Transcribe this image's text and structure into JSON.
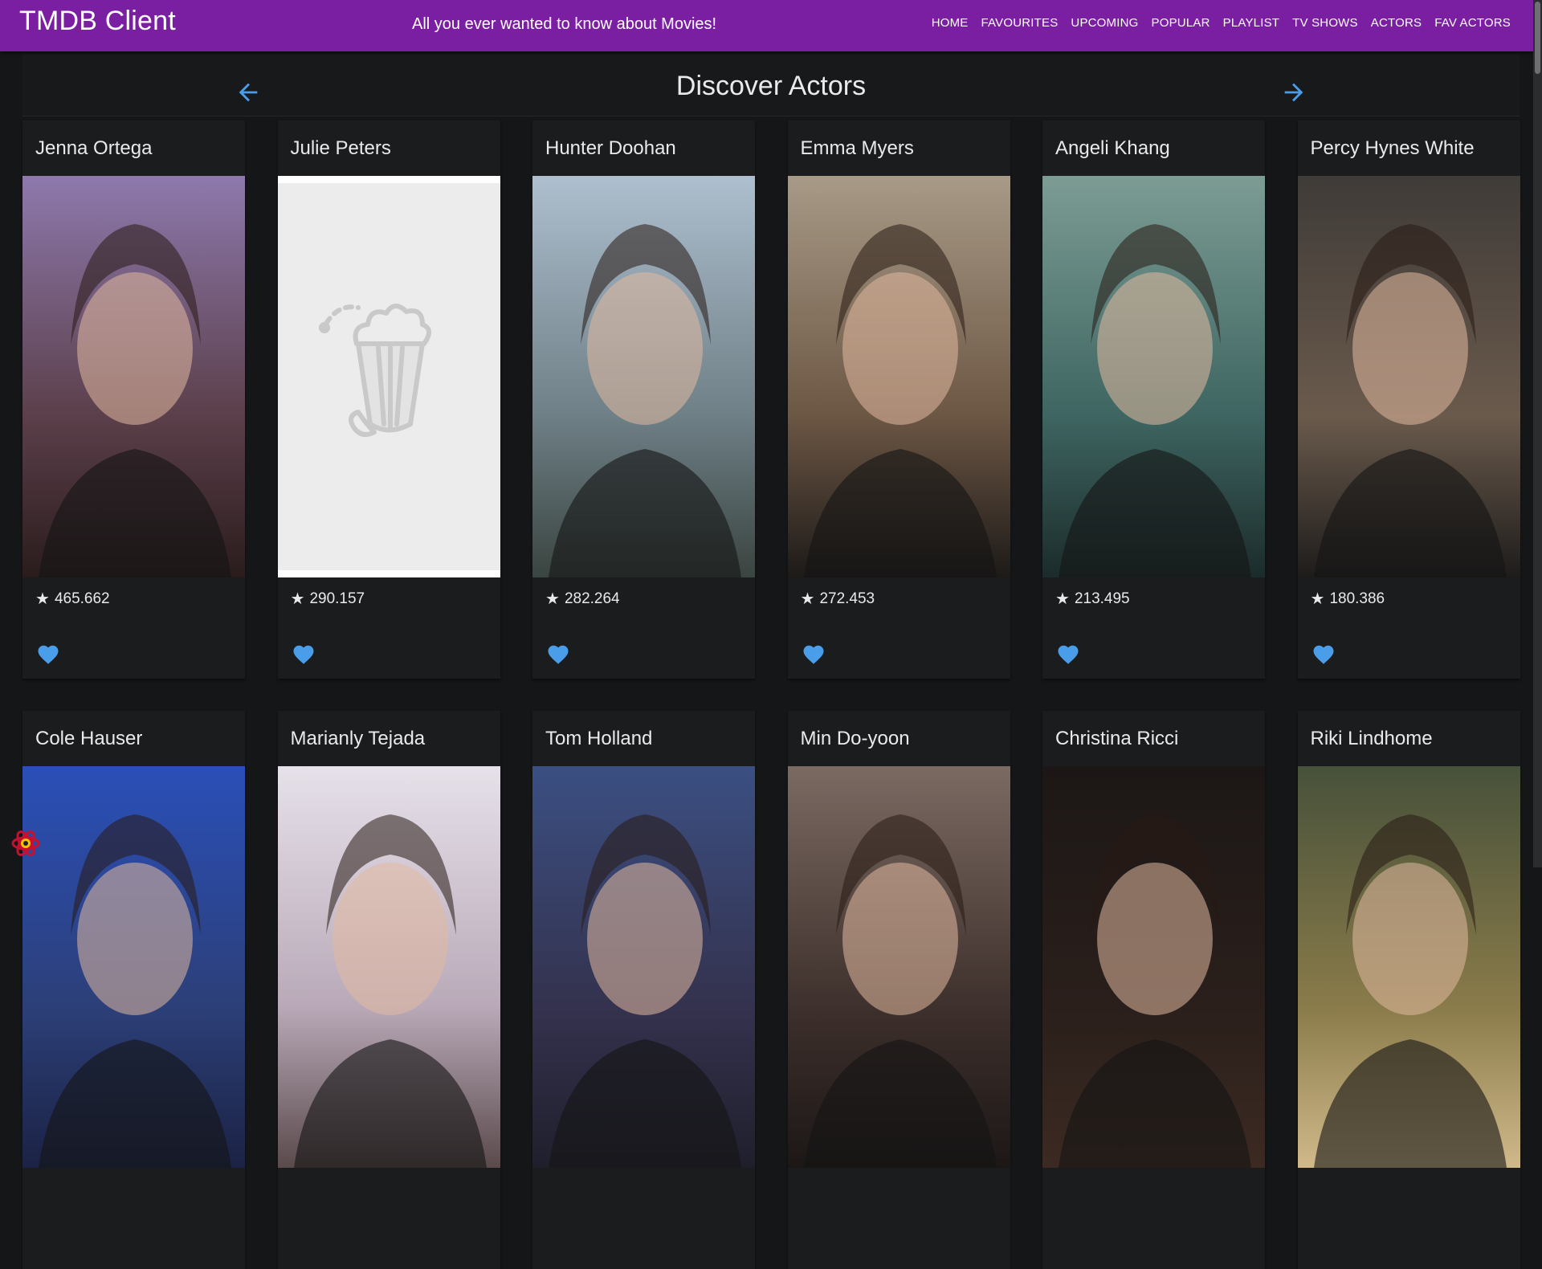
{
  "app": {
    "title": "TMDB Client",
    "tagline": "All you ever wanted to know about Movies!",
    "nav": [
      "HOME",
      "FAVOURITES",
      "UPCOMING",
      "POPULAR",
      "PLAYLIST",
      "TV SHOWS",
      "ACTORS",
      "FAV ACTORS"
    ]
  },
  "page": {
    "title": "Discover Actors",
    "prev_icon": "arrow-left-icon",
    "next_icon": "arrow-right-icon"
  },
  "colors": {
    "appbar": "#7b1fa2",
    "background": "#141618",
    "card": "#1a1c1e",
    "accent": "#4a9de8"
  },
  "actors": [
    {
      "name": "Jenna Ortega",
      "rating": "465.662",
      "image": "photo",
      "tone": "purple"
    },
    {
      "name": "Julie Peters",
      "rating": "290.157",
      "image": "placeholder-popcorn",
      "tone": "grey"
    },
    {
      "name": "Hunter Doohan",
      "rating": "282.264",
      "image": "photo",
      "tone": "sky"
    },
    {
      "name": "Emma Myers",
      "rating": "272.453",
      "image": "photo",
      "tone": "warm"
    },
    {
      "name": "Angeli Khang",
      "rating": "213.495",
      "image": "photo",
      "tone": "teal"
    },
    {
      "name": "Percy Hynes White",
      "rating": "180.386",
      "image": "photo",
      "tone": "dark"
    },
    {
      "name": "Cole Hauser",
      "rating": "",
      "image": "photo",
      "tone": "blue"
    },
    {
      "name": "Marianly Tejada",
      "rating": "",
      "image": "photo",
      "tone": "light"
    },
    {
      "name": "Tom Holland",
      "rating": "",
      "image": "photo",
      "tone": "navy"
    },
    {
      "name": "Min Do-yoon",
      "rating": "",
      "image": "photo",
      "tone": "brick"
    },
    {
      "name": "Christina Ricci",
      "rating": "",
      "image": "photo",
      "tone": "black"
    },
    {
      "name": "Riki Lindhome",
      "rating": "",
      "image": "photo",
      "tone": "olive"
    }
  ]
}
